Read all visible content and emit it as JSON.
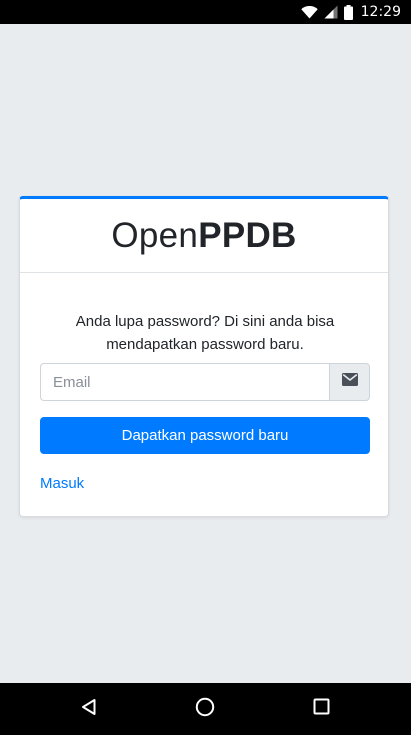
{
  "status_bar": {
    "time": "12:29",
    "icons": [
      "wifi-icon",
      "signal-icon",
      "battery-icon"
    ]
  },
  "card": {
    "brand_light": "Open",
    "brand_bold": "PPDB",
    "message": "Anda lupa password? Di sini anda bisa mendapatkan password baru.",
    "email_placeholder": "Email",
    "email_value": "",
    "email_icon": "envelope-icon",
    "submit_label": "Dapatkan password baru",
    "login_link": "Masuk"
  },
  "nav_bar": {
    "buttons": [
      "back-icon",
      "home-icon",
      "recents-icon"
    ]
  },
  "colors": {
    "accent": "#007bff",
    "background": "#e9ecef",
    "text": "#212529"
  }
}
